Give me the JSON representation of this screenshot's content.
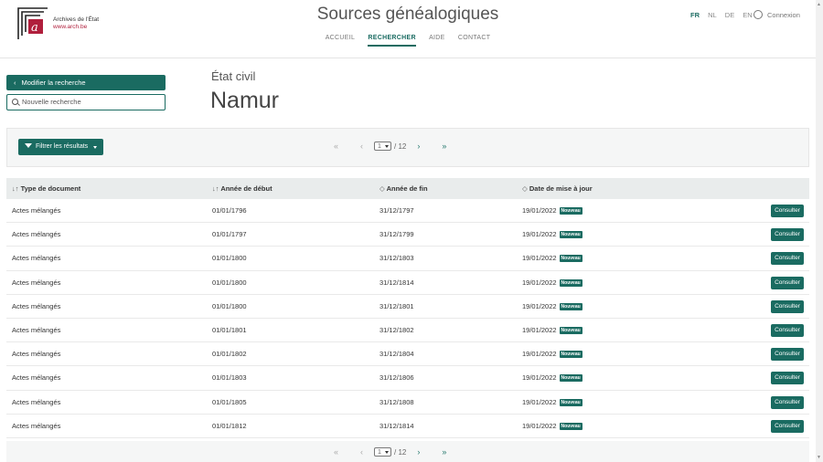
{
  "header": {
    "logo_line1": "Archives de l'État",
    "logo_line2": "www.arch.be",
    "site_title": "Sources généalogiques",
    "nav": [
      {
        "label": "ACCUEIL",
        "active": false
      },
      {
        "label": "RECHERCHER",
        "active": true
      },
      {
        "label": "AIDE",
        "active": false
      },
      {
        "label": "CONTACT",
        "active": false
      }
    ],
    "languages": [
      {
        "label": "FR",
        "active": true
      },
      {
        "label": "NL",
        "active": false
      },
      {
        "label": "DE",
        "active": false
      },
      {
        "label": "EN",
        "active": false
      }
    ],
    "login_label": "Connexion"
  },
  "sidebar": {
    "modify_label": "Modifier la recherche",
    "new_search_label": "Nouvelle recherche"
  },
  "main": {
    "subtitle": "État civil",
    "title": "Namur"
  },
  "filter": {
    "button_label": "Filtrer les résultats"
  },
  "pagination": {
    "current": "1",
    "total_text": "/ 12"
  },
  "table": {
    "headers": {
      "type": "Type de document",
      "start": "Année de début",
      "end": "Année de fin",
      "updated": "Date de mise à jour"
    },
    "badge": "Nouveau",
    "consult_label": "Consulter",
    "rows": [
      {
        "type": "Actes mélangés",
        "start": "01/01/1796",
        "end": "31/12/1797",
        "updated": "19/01/2022"
      },
      {
        "type": "Actes mélangés",
        "start": "01/01/1797",
        "end": "31/12/1799",
        "updated": "19/01/2022"
      },
      {
        "type": "Actes mélangés",
        "start": "01/01/1800",
        "end": "31/12/1803",
        "updated": "19/01/2022"
      },
      {
        "type": "Actes mélangés",
        "start": "01/01/1800",
        "end": "31/12/1814",
        "updated": "19/01/2022"
      },
      {
        "type": "Actes mélangés",
        "start": "01/01/1800",
        "end": "31/12/1801",
        "updated": "19/01/2022"
      },
      {
        "type": "Actes mélangés",
        "start": "01/01/1801",
        "end": "31/12/1802",
        "updated": "19/01/2022"
      },
      {
        "type": "Actes mélangés",
        "start": "01/01/1802",
        "end": "31/12/1804",
        "updated": "19/01/2022"
      },
      {
        "type": "Actes mélangés",
        "start": "01/01/1803",
        "end": "31/12/1806",
        "updated": "19/01/2022"
      },
      {
        "type": "Actes mélangés",
        "start": "01/01/1805",
        "end": "31/12/1808",
        "updated": "19/01/2022"
      },
      {
        "type": "Actes mélangés",
        "start": "01/01/1812",
        "end": "31/12/1814",
        "updated": "19/01/2022"
      }
    ]
  },
  "icons": {
    "back": "chevron-left-icon",
    "search": "search-icon",
    "filter": "filter-icon",
    "sort": "sort-icon",
    "user": "user-icon"
  },
  "colors": {
    "accent": "#1a6b61",
    "brand": "#b01f3c"
  }
}
